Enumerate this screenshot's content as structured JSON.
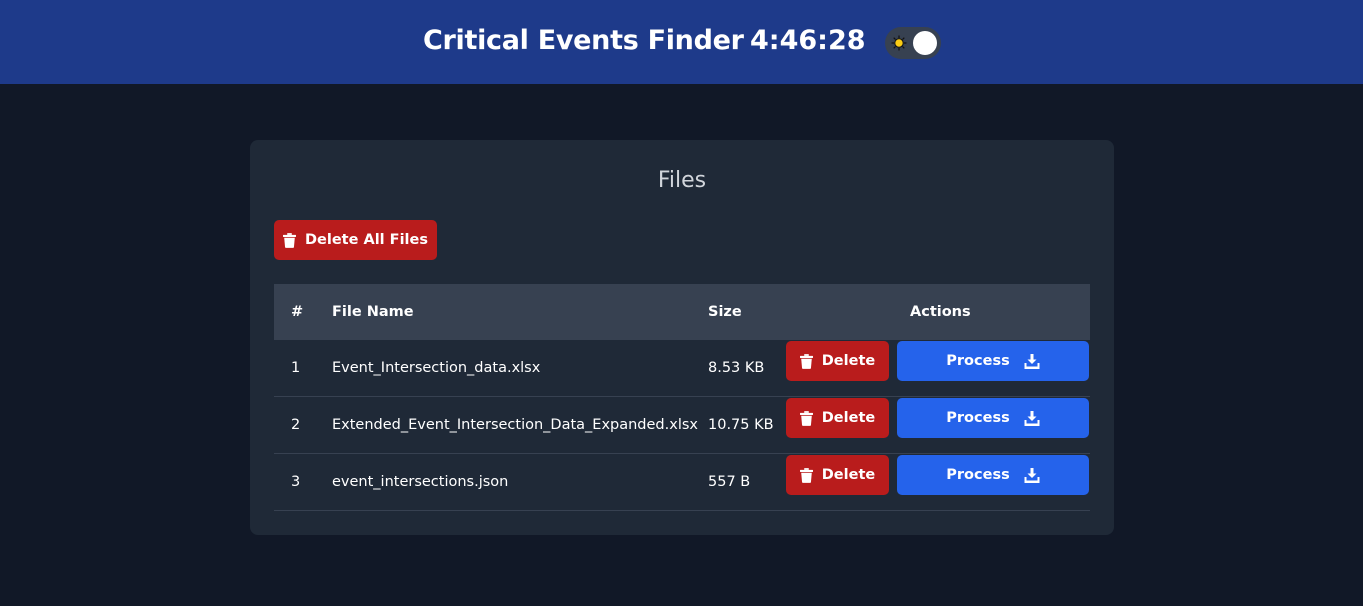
{
  "header": {
    "title": "Critical Events Finder",
    "clock": "4:46:28",
    "theme_toggle_icon": "sun-icon"
  },
  "files_panel": {
    "title": "Files",
    "delete_all_label": "Delete All Files",
    "columns": [
      "#",
      "File Name",
      "Size",
      "Actions"
    ],
    "rows": [
      {
        "index": "1",
        "name": "Event_Intersection_data.xlsx",
        "size": "8.53 KB",
        "delete_label": "Delete",
        "process_label": "Process"
      },
      {
        "index": "2",
        "name": "Extended_Event_Intersection_Data_Expanded.xlsx",
        "size": "10.75 KB",
        "delete_label": "Delete",
        "process_label": "Process"
      },
      {
        "index": "3",
        "name": "event_intersections.json",
        "size": "557 B",
        "delete_label": "Delete",
        "process_label": "Process"
      }
    ]
  },
  "colors": {
    "header_bg": "#1e3a8a",
    "page_bg": "#111827",
    "card_bg": "#1f2937",
    "table_header_bg": "#374151",
    "danger": "#b91c1c",
    "primary": "#2563eb"
  }
}
